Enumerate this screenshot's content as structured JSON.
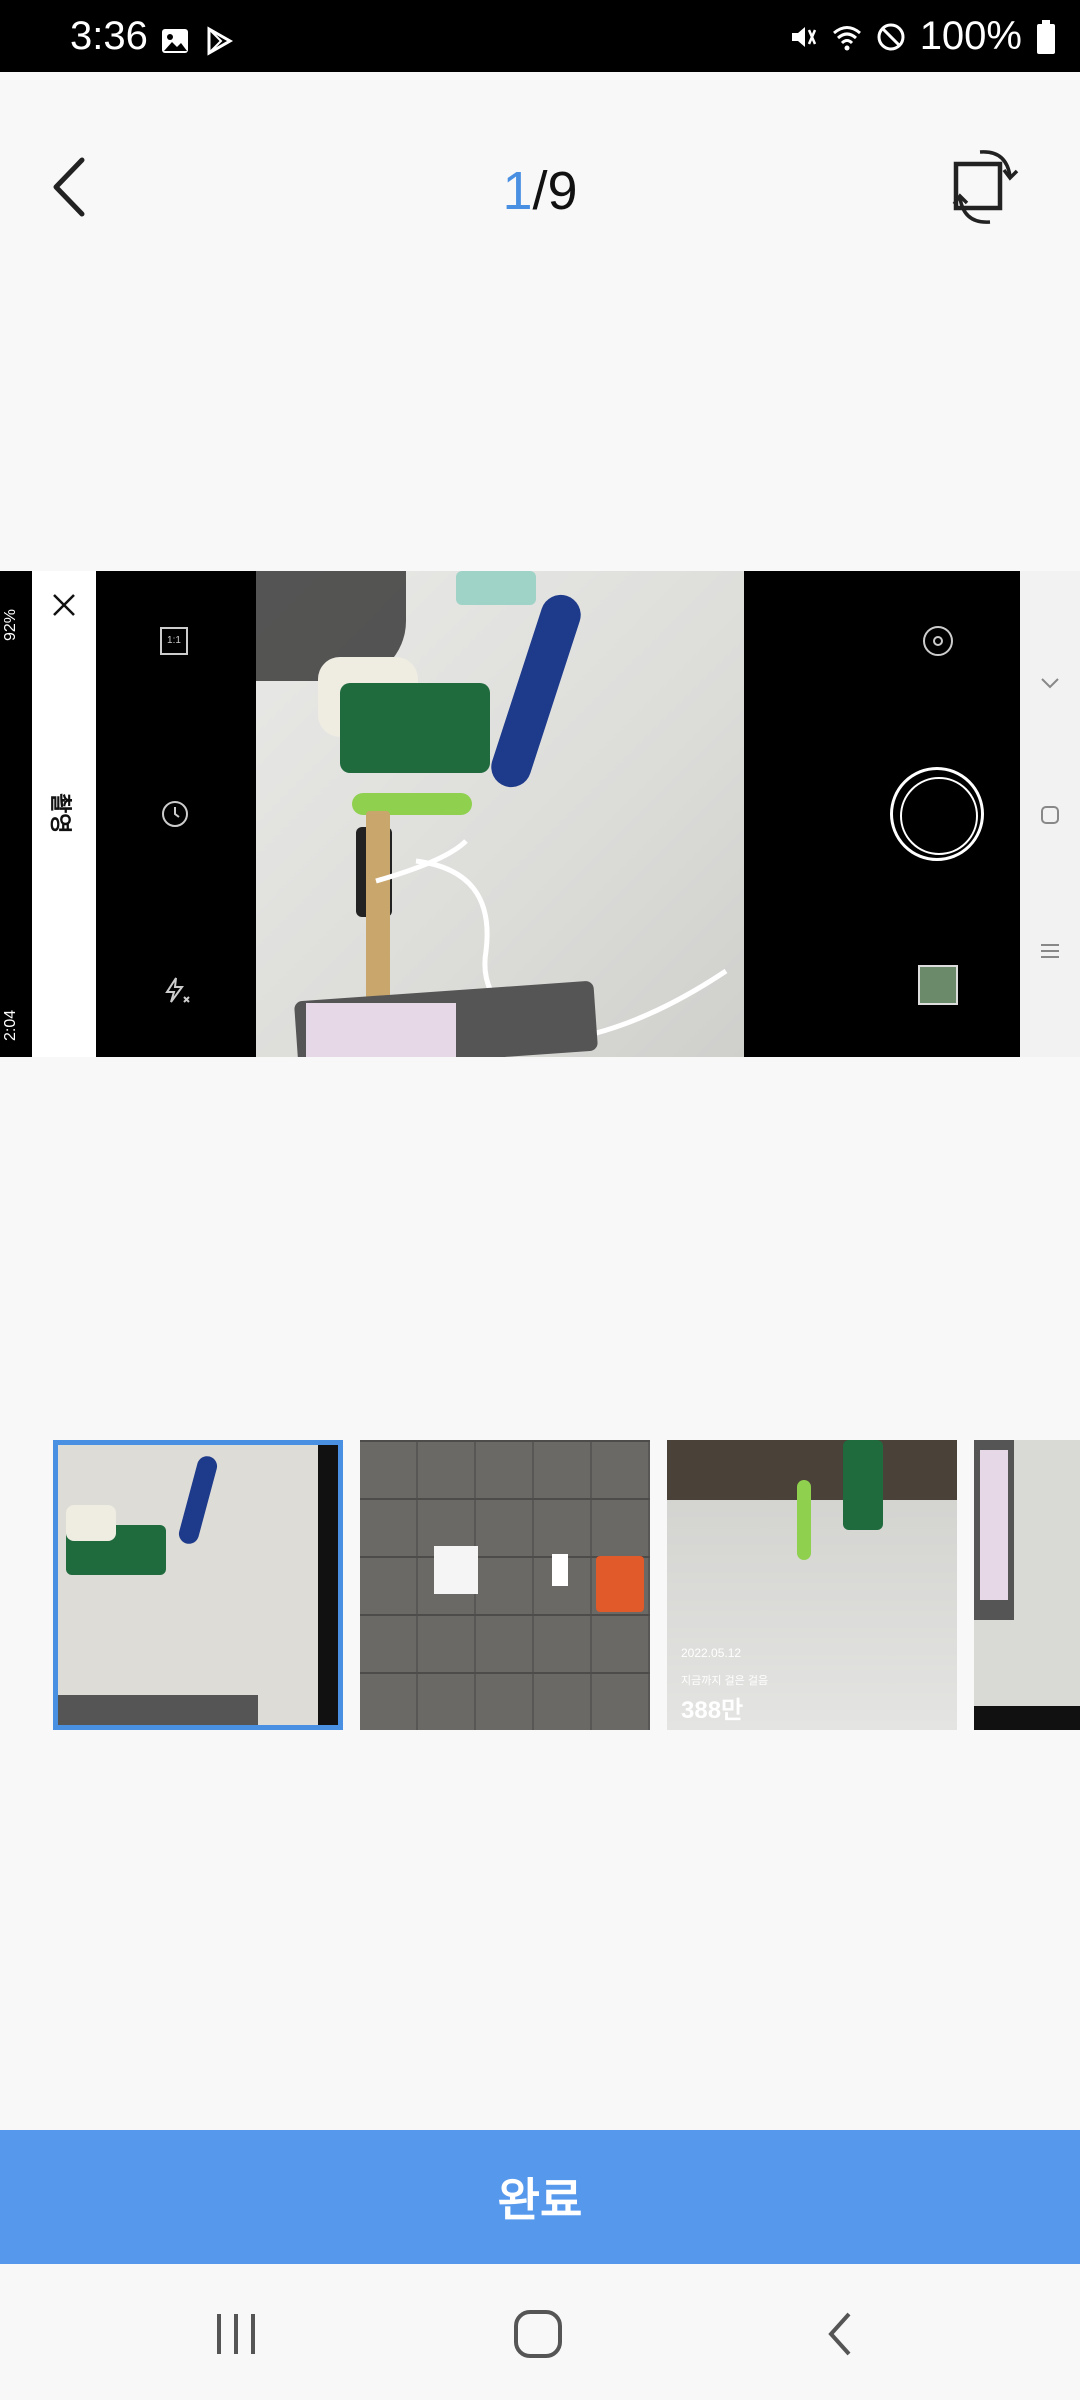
{
  "status_bar": {
    "time": "3:36",
    "battery": "100%",
    "icons": [
      "gallery-icon",
      "play-store-icon",
      "mute-icon",
      "wifi-icon",
      "do-not-disturb-icon",
      "battery-icon"
    ]
  },
  "header": {
    "current_page": "1",
    "total_pages": "/9"
  },
  "main_photo": {
    "camera_mode_label": "촬영",
    "screenshot_time": "2:04",
    "screenshot_battery": "92%",
    "ratio_label": "1:1"
  },
  "thumbnails": [
    {
      "selected": true
    },
    {
      "selected": false
    },
    {
      "selected": false,
      "date": "2022.05.12",
      "subtitle": "지금까지 걸은 걸음",
      "count": "388만"
    },
    {
      "selected": false
    }
  ],
  "footer": {
    "done_label": "완료"
  },
  "colors": {
    "accent": "#4a90e2",
    "button": "#5598ec",
    "background": "#f8f8f9"
  }
}
